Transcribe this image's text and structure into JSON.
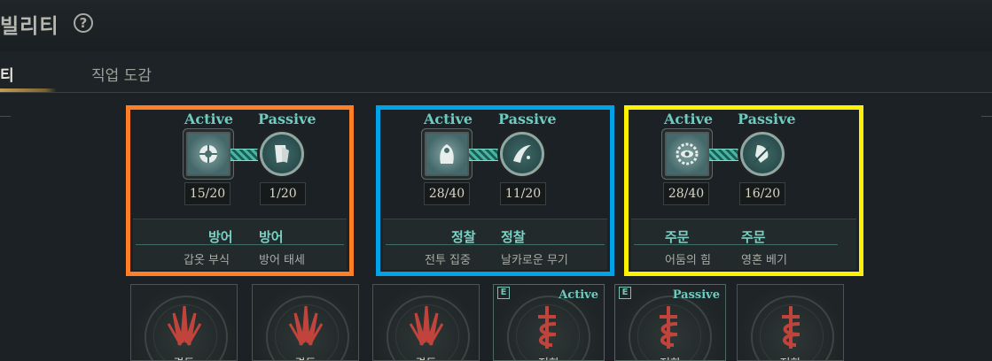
{
  "header": {
    "title": "빌리티",
    "help_icon": "?"
  },
  "tabs": [
    {
      "label": "티",
      "active": true
    },
    {
      "label": "직업 도감",
      "active": false
    }
  ],
  "colors": {
    "orange": "#ff7f27",
    "blue": "#00a2e8",
    "yellow": "#fff200",
    "accent": "#6ecbc0"
  },
  "groups": [
    {
      "active_label": "Active",
      "passive_label": "Passive",
      "active_count": "15/20",
      "passive_count": "1/20",
      "cat_active": "방어",
      "cat_passive": "방어",
      "skill_active": "갑옷 부식",
      "skill_passive": "방어 태세"
    },
    {
      "active_label": "Active",
      "passive_label": "Passive",
      "active_count": "28/40",
      "passive_count": "11/20",
      "cat_active": "정찰",
      "cat_passive": "정찰",
      "skill_active": "전투 집중",
      "skill_passive": "날카로운 무기"
    },
    {
      "active_label": "Active",
      "passive_label": "Passive",
      "active_count": "28/40",
      "passive_count": "16/20",
      "cat_active": "주문",
      "cat_passive": "주문",
      "skill_active": "어둠의 힘",
      "skill_passive": "영혼 베기"
    }
  ],
  "cards": [
    {
      "icon": "trident-icon",
      "badge": "",
      "tag": "",
      "label": "격투"
    },
    {
      "icon": "trident-icon",
      "badge": "",
      "tag": "",
      "label": "격투"
    },
    {
      "icon": "trident-icon",
      "badge": "",
      "tag": "",
      "label": "격투"
    },
    {
      "icon": "serpent-dagger-icon",
      "badge": "E",
      "tag": "Active",
      "label": "저항"
    },
    {
      "icon": "serpent-dagger-icon",
      "badge": "E",
      "tag": "Passive",
      "label": "저항"
    },
    {
      "icon": "serpent-dagger-icon",
      "badge": "",
      "tag": "",
      "label": "저항"
    }
  ]
}
